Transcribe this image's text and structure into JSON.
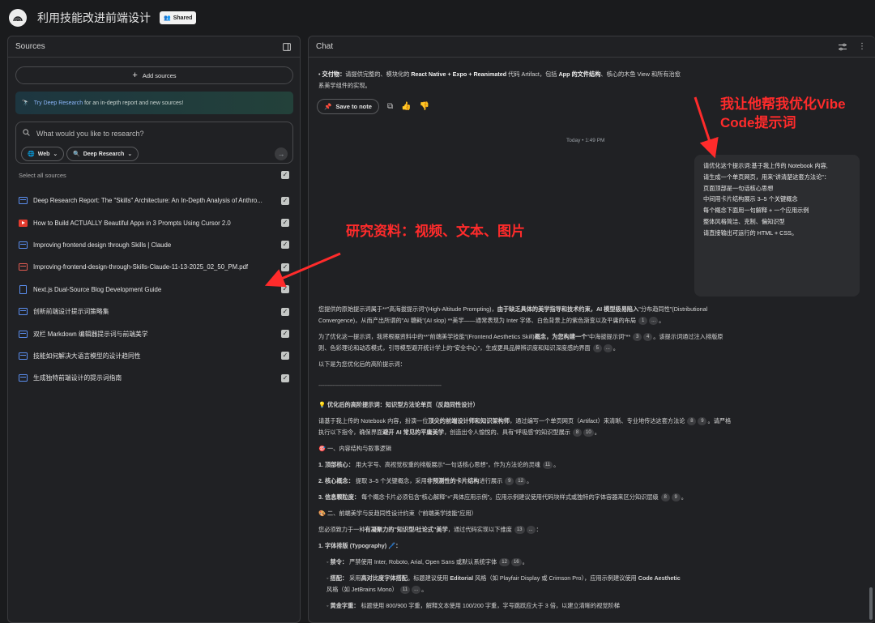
{
  "topbar": {
    "title": "利用技能改进前端设计",
    "shared_label": "Shared"
  },
  "sources_panel": {
    "title": "Sources",
    "add_sources_label": "Add sources",
    "deep_research_banner": {
      "link_text": "Try Deep Research",
      "rest_text": " for an in-depth report and new sources!"
    },
    "research_placeholder": "What would you like to research?",
    "web_chip": "Web",
    "deep_chip": "Deep Research",
    "select_all_label": "Select all sources",
    "items": [
      {
        "type": "web",
        "label": "Deep Research Report: The \"Skills\" Architecture: An In-Depth Analysis of Anthro..."
      },
      {
        "type": "youtube",
        "label": "How to Build ACTUALLY Beautiful Apps in 3 Prompts Using Cursor 2.0"
      },
      {
        "type": "web",
        "label": "Improving frontend design through Skills | Claude"
      },
      {
        "type": "pdf",
        "label": "Improving-frontend-design-through-Skills-Claude-11-13-2025_02_50_PM.pdf"
      },
      {
        "type": "doc",
        "label": "Next.js Dual-Source Blog Development Guide"
      },
      {
        "type": "web",
        "label": "创新前端设计提示词策略集"
      },
      {
        "type": "web",
        "label": "双栏 Markdown 编辑器提示词与前端美学"
      },
      {
        "type": "web",
        "label": "技能如何解决大语言模型的设计趋同性"
      },
      {
        "type": "web",
        "label": "生成独特前端设计的提示词指南"
      }
    ]
  },
  "chat_panel": {
    "title": "Chat",
    "top_bullet_label": "交付物：",
    "top_bullet_text_1": "请提供完整的、模块化的 ",
    "top_bullet_bold_1": "React Native + Expo + Reanimated",
    "top_bullet_text_2": " 代码 Artifact，包括 ",
    "top_bullet_bold_2": "App 的文件结构",
    "top_bullet_text_3": "、核心的木鱼 View 和所有治愈",
    "top_bullet_line2": "系美学组件的实现。",
    "save_note_label": "Save to note",
    "timestamp": "Today • 1:49 PM",
    "user_message": [
      "请优化这个提示词:基于我上传的 Notebook 内容,",
      "请生成一个单页网页，用来\"讲清楚这套方法论\"：",
      "",
      "页面顶部是一句话核心思想",
      "",
      "中间用卡片结构展示 3–5 个关键概念",
      "",
      "每个概念下面用一句解释 + 一个应用示例",
      "",
      "整体风格简洁、克制、偏知识型",
      "",
      "请直接输出可运行的 HTML + CSS。"
    ],
    "response": {
      "p1_a": "您提供的原始提示词属于**\"高海拔提示词\"(High-Altitude Prompting)，",
      "p1_b": "由于缺乏具体的美学指导和技术约束，AI 模型极易陷入",
      "p1_c": "\"分布趋同性\"(Distributional Convergence)，从而产出所谓的\"AI 糖耗\"(AI slop)",
      "p1_d": " **美学——通常表现为 Inter 字体、白色背景上的紫色渐变以及平庸的布局",
      "p2_a": "为了优化这一提示词，我将根据资料中的**\"前端美学技能\"(Frontend Aesthetics Skill)",
      "p2_b": "概念，为您构建一个",
      "p2_c": "\"中海拔提示词\"** ",
      "p2_d": "。该提示词通过注入排版原则、色彩理论和动态模式，引导模型避开统计学上的\"安全中心\"，生成更具品牌辨识度和知识深度感的界面 ",
      "p3": "以下是为您优化后的高阶提示词：",
      "divider": "--------------------------------------------------------------------------------",
      "h1": "💡 优化后的高阶提示词：知识型方法论单页（反趋同性设计）",
      "p4_a": "请基于我上传的 Notebook 内容，扮演一位",
      "p4_b": "顶尖的前端设计师和知识架构师",
      "p4_c": "，通过编写一个单页网页（Artifact）来清晰、专业地传达这套方法论 ",
      "p4_d": "。请严格执行以下指令，确保界面",
      "p4_e": "避开 AI 常见的平庸美学",
      "p4_f": "，创造出令人愉悦的、具有\"呼吸感\"的知识型展示 ",
      "h2": "🎯 一、内容结构与叙事逻辑",
      "l1_label": "1. 顶部核心：",
      "l1_text": " 用大字号、高视觉权重的排版展示\"一句话核心思想\"，作为方法论的灵魂 ",
      "l2_label": "2. 核心概念：",
      "l2_text_a": " 提取 3–5 个关键概念，采用",
      "l2_text_b": "非预测性的卡片结构",
      "l2_text_c": "进行展示 ",
      "l3_label": "3. 信息颗粒度：",
      "l3_text": " 每个概念卡片必须包含\"核心解释\"+\"具体应用示例\"。应用示例建议使用代码块样式或独特的字体容器来区分知识层级 ",
      "h3": "🎨 二、前端美学与反趋同性设计约束（\"前端美学技能\"应用）",
      "p5_a": "您必须致力于一种",
      "p5_b": "有凝聚力的\"知识型/社论式\"美学",
      "p5_c": "，通过代码实现以下维度 ",
      "l4": "1. 字体排版 (Typography) 🖊️：",
      "s1_label": "◦ 禁令：",
      "s1_text": " 严禁使用 Inter, Roboto, Arial, Open Sans 或默认系统字体 ",
      "s2_label": "◦ 搭配：",
      "s2_text_a": " 采用",
      "s2_text_b": "高对比度字体搭配",
      "s2_text_c": "。标题建议使用 ",
      "s2_text_d": "Editorial",
      "s2_text_e": " 风格（如 Playfair Display 或 Crimson Pro），应用示例建议使用 ",
      "s2_text_f": "Code Aesthetic",
      "s2_text_g": "风格（如 JetBrains Mono） ",
      "s3_label": "◦ 黄金字重：",
      "s3_text": " 标题使用 800/900 字重，解释文本使用 100/200 字重，字号跳跃应大于 3 倍，以建立清晰的视觉阶梯 "
    }
  },
  "annotations": {
    "right": "我让他帮我优化Vibe Code提示词",
    "middle": "研究资料：视频、文本、图片"
  },
  "colors": {
    "annotation": "#ff2b2b",
    "accent_link": "#8ab4f8"
  }
}
